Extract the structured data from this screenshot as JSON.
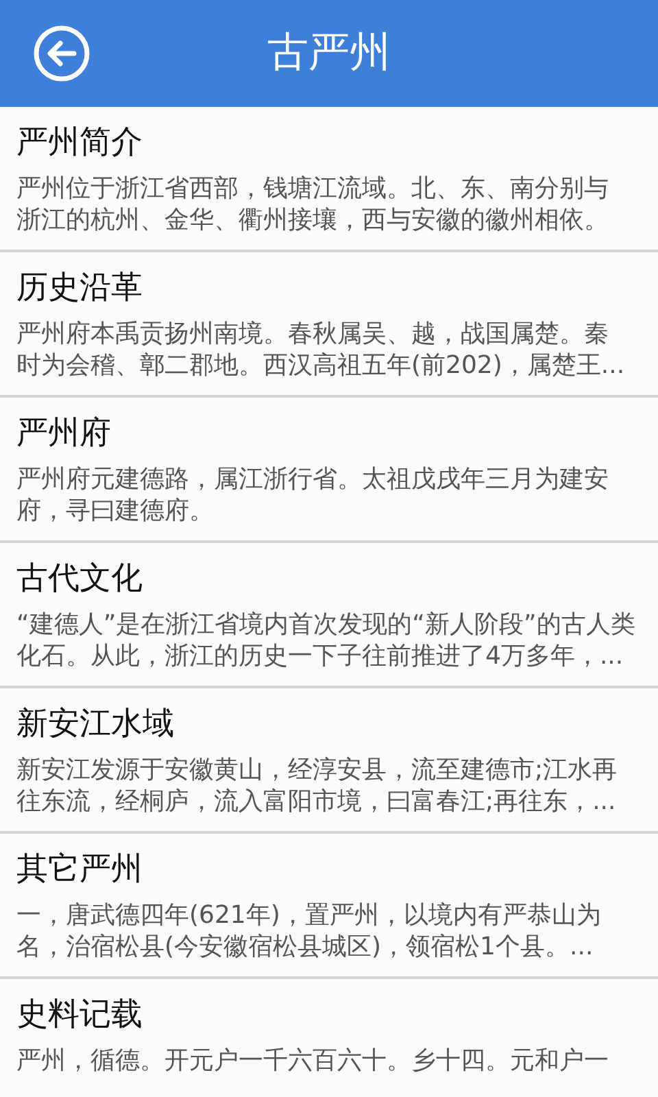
{
  "header": {
    "title": "古严州"
  },
  "items": [
    {
      "title": "严州简介",
      "lines": [
        "严州位于浙江省西部，钱塘江流域。北、东、南分别与",
        "浙江的杭州、金华、衢州接壤，西与安徽的徽州相依。"
      ]
    },
    {
      "title": "历史沿革",
      "lines": [
        "严州府本禹贡扬州南境。春秋属吴、越，战国属楚。秦",
        "时为会稽、鄣二郡地。西汉高祖五年(前202)，属楚王..."
      ]
    },
    {
      "title": "严州府",
      "lines": [
        "严州府元建德路，属江浙行省。太祖戊戌年三月为建安",
        "府，寻曰建德府。"
      ]
    },
    {
      "title": "古代文化",
      "lines": [
        "“建德人”是在浙江省境内首次发现的“新人阶段”的古人类",
        "化石。从此，浙江的历史一下子往前推进了4万多年，..."
      ]
    },
    {
      "title": "新安江水域",
      "lines": [
        "新安江发源于安徽黄山，经淳安县，流至建德市;江水再",
        "往东流，经桐庐，流入富阳市境，曰富春江;再往东，..."
      ]
    },
    {
      "title": "其它严州",
      "lines": [
        "一，唐武德四年(621年)，置严州，以境内有严恭山为",
        "名，治宿松县(今安徽宿松县城区)，领宿松1个县。..."
      ]
    },
    {
      "title": "史料记载",
      "lines": [
        "严州，循德。开元户一千六百六十。乡十四。元和户一"
      ]
    }
  ]
}
